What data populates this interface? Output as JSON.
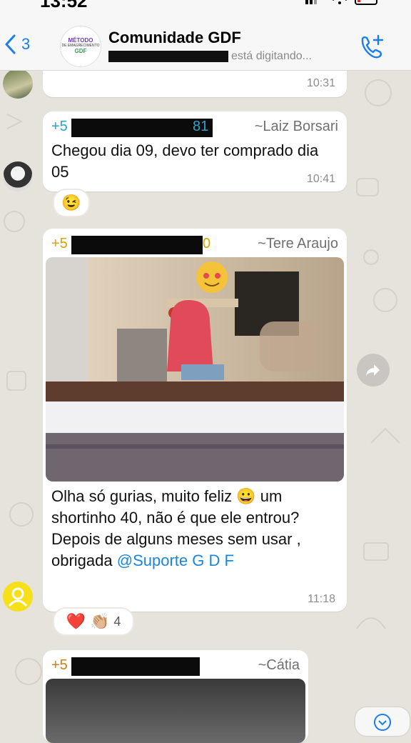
{
  "status_bar": {
    "time": "13:52"
  },
  "header": {
    "back_count": "3",
    "avatar_lines": [
      "MÉTODO",
      "DE EMAGRECIMENTO",
      "GDF"
    ],
    "title": "Comunidade GDF",
    "subtitle": "está digitando..."
  },
  "messages": [
    {
      "time": "10:31"
    },
    {
      "phone_prefix": "+5",
      "phone_suffix": "81",
      "phone_color": "#2aa4c8",
      "alias": "~Laiz Borsari",
      "text": "Chegou dia 09, devo ter comprado dia 05",
      "time": "10:41",
      "reaction": "😉"
    },
    {
      "phone_prefix": "+5",
      "phone_suffix": "0",
      "phone_color": "#d9a400",
      "alias": "~Tere Araujo",
      "text_before": "Olha só gurias, muito feliz 😀 um shortinho 40, não é que ele entrou? Depois de alguns meses sem usar , obrigada ",
      "mention": "@Suporte G D F",
      "time": "11:18",
      "reactions": [
        "❤️",
        "👏🏼"
      ],
      "reaction_count": "4"
    },
    {
      "phone_prefix": "+5",
      "phone_suffix": "",
      "phone_color": "#c8821a",
      "alias": "~Cátia"
    }
  ],
  "colors": {
    "accent": "#1a7df0",
    "bubble": "#ffffff",
    "background": "#e6e2dc"
  }
}
